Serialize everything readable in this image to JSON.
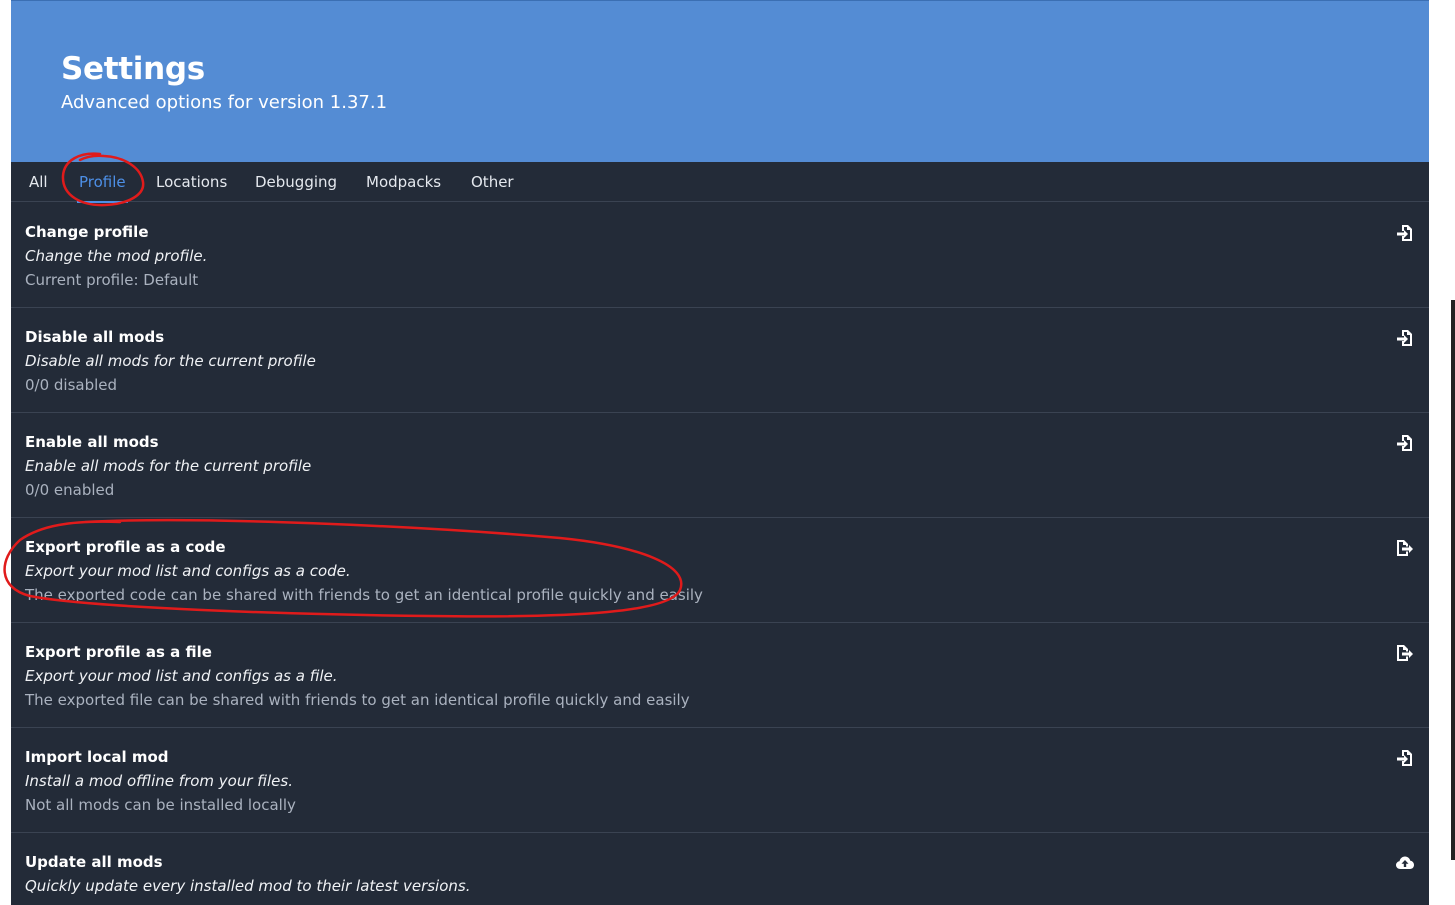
{
  "header": {
    "title": "Settings",
    "subtitle": "Advanced options for version 1.37.1"
  },
  "tabs": [
    {
      "label": "All",
      "active": false
    },
    {
      "label": "Profile",
      "active": true
    },
    {
      "label": "Locations",
      "active": false
    },
    {
      "label": "Debugging",
      "active": false
    },
    {
      "label": "Modpacks",
      "active": false
    },
    {
      "label": "Other",
      "active": false
    }
  ],
  "settings": [
    {
      "title": "Change profile",
      "description": "Change the mod profile.",
      "value": "Current profile: Default",
      "icon": "file-import-icon"
    },
    {
      "title": "Disable all mods",
      "description": "Disable all mods for the current profile",
      "value": "0/0 disabled",
      "icon": "file-import-icon"
    },
    {
      "title": "Enable all mods",
      "description": "Enable all mods for the current profile",
      "value": "0/0 enabled",
      "icon": "file-import-icon"
    },
    {
      "title": "Export profile as a code",
      "description": "Export your mod list and configs as a code.",
      "value": "The exported code can be shared with friends to get an identical profile quickly and easily",
      "icon": "file-export-icon"
    },
    {
      "title": "Export profile as a file",
      "description": "Export your mod list and configs as a file.",
      "value": "The exported file can be shared with friends to get an identical profile quickly and easily",
      "icon": "file-export-icon"
    },
    {
      "title": "Import local mod",
      "description": "Install a mod offline from your files.",
      "value": "Not all mods can be installed locally",
      "icon": "file-import-icon"
    },
    {
      "title": "Update all mods",
      "description": "Quickly update every installed mod to their latest versions.",
      "value": "",
      "icon": "cloud-upload-icon"
    }
  ],
  "colors": {
    "header_bg": "#548cd4",
    "page_bg": "#232b38",
    "accent": "#4d8fe6",
    "annotation": "#e01b1b"
  }
}
